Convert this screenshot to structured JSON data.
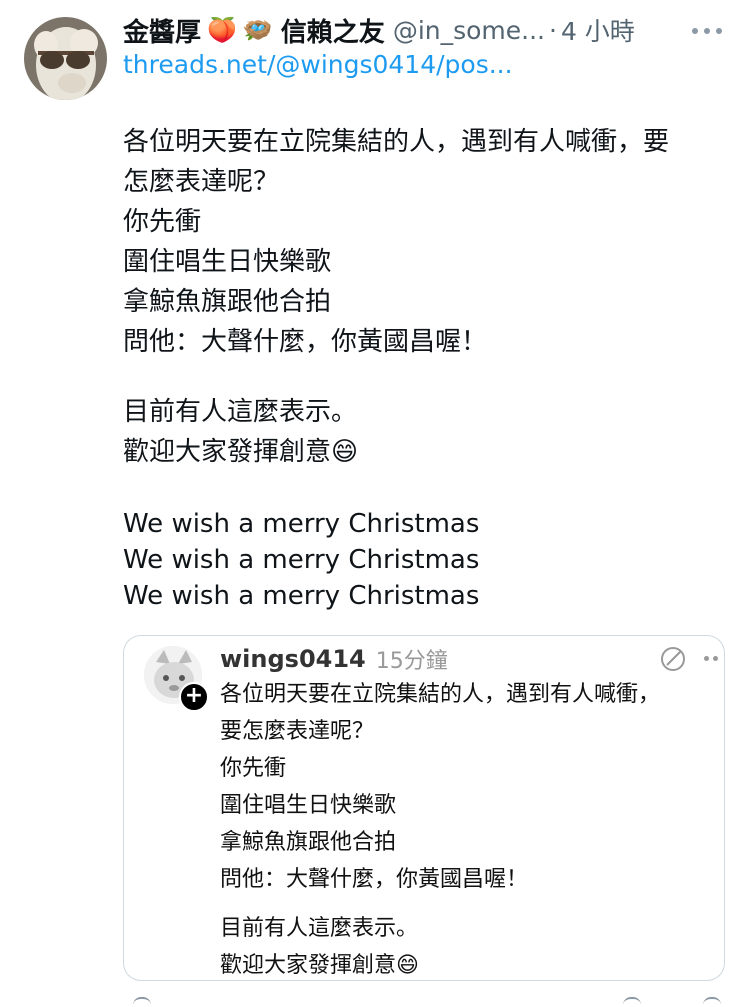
{
  "author": {
    "name": "金醬厚",
    "emoji_1": "🍑",
    "emoji_2": "🪺",
    "name_suffix": "信賴之友",
    "handle": "@in_some...",
    "separator": "·",
    "time": "4 小時"
  },
  "link": "threads.net/@wings0414/pos...",
  "post_lines": [
    "各位明天要在立院集結的人，遇到有人喊衝，要",
    "怎麼表達呢？",
    "你先衝",
    "圍住唱生日快樂歌",
    "拿鯨魚旗跟他合拍",
    "問他：大聲什麼，你黃國昌喔！",
    "目前有人這麼表示。",
    "歡迎大家發揮創意😄",
    "We wish a merry Christmas",
    "We wish a merry Christmas",
    "We wish a merry Christmas"
  ],
  "quote": {
    "name": "wings0414",
    "time": "15分鐘",
    "plus": "+",
    "lines": [
      "各位明天要在立院集結的人，遇到有人喊衝，",
      "要怎麼表達呢？",
      "你先衝",
      "圍住唱生日快樂歌",
      "拿鯨魚旗跟他合拍",
      "問他：大聲什麼，你黃國昌喔！",
      "目前有人這麼表示。",
      "歡迎大家發揮創意😄"
    ]
  },
  "colors": {
    "link": "#1d9bf0",
    "muted": "#536471",
    "border": "#cfd9de"
  },
  "icons": [
    "more-icon",
    "edit-icon",
    "plus-icon",
    "alpaca-avatar",
    "cat-avatar"
  ]
}
